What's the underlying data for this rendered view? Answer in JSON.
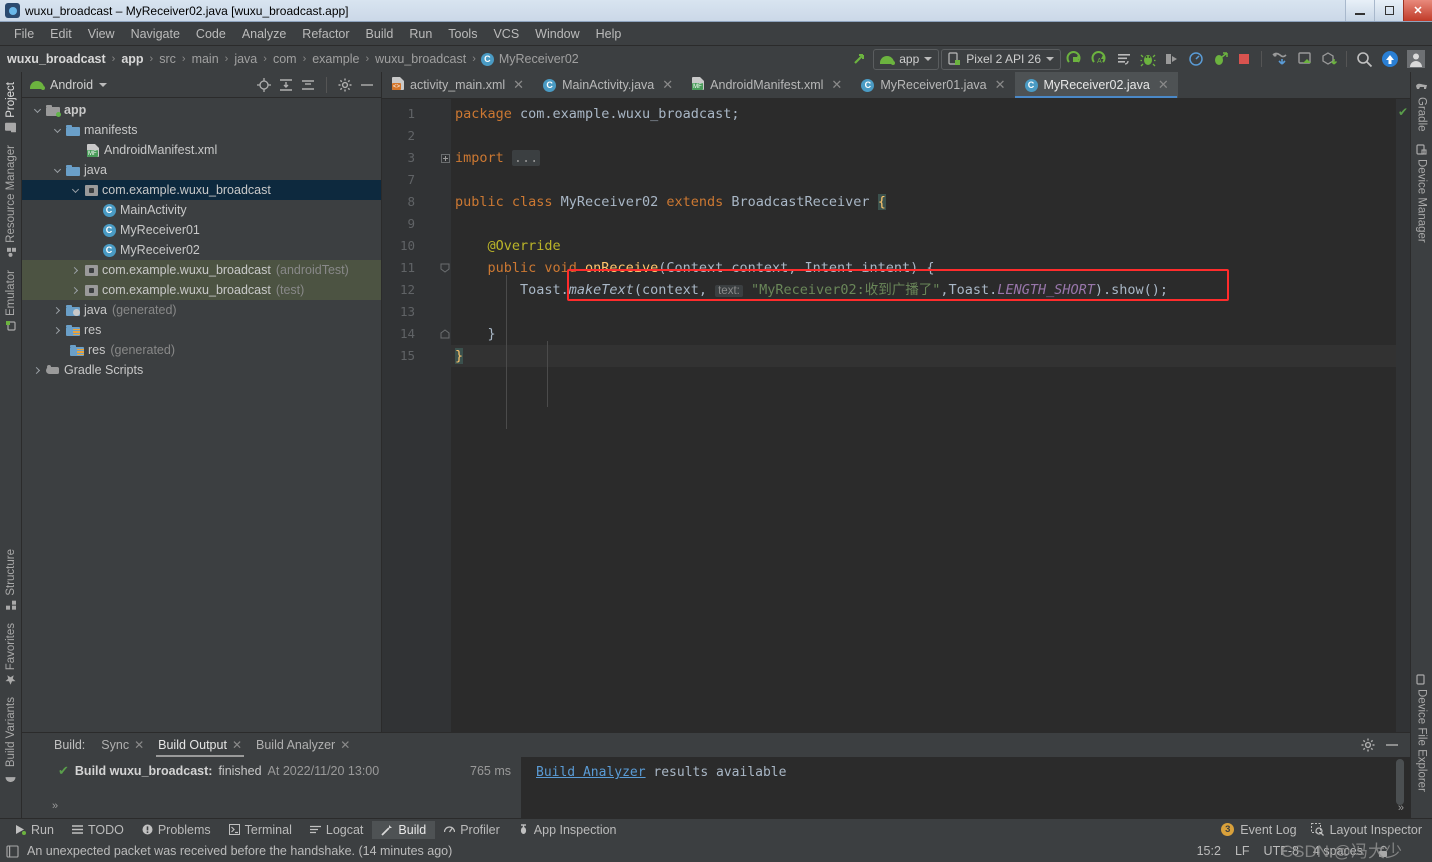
{
  "window": {
    "title": "wuxu_broadcast – MyReceiver02.java [wuxu_broadcast.app]",
    "minimize": "–",
    "maximize": "❐",
    "close": "✕"
  },
  "menubar": {
    "items": [
      "File",
      "Edit",
      "View",
      "Navigate",
      "Code",
      "Analyze",
      "Refactor",
      "Build",
      "Run",
      "Tools",
      "VCS",
      "Window",
      "Help"
    ]
  },
  "navbar": {
    "breadcrumbs": [
      {
        "label": "wuxu_broadcast",
        "bold": true
      },
      {
        "label": "app",
        "bold": true
      },
      {
        "label": "src",
        "bold": false
      },
      {
        "label": "main",
        "bold": false
      },
      {
        "label": "java",
        "bold": false
      },
      {
        "label": "com",
        "bold": false
      },
      {
        "label": "example",
        "bold": false
      },
      {
        "label": "wuxu_broadcast",
        "bold": false
      },
      {
        "label": "MyReceiver02",
        "bold": false,
        "icon": "class-icon",
        "badge": "C"
      }
    ],
    "separator": "›",
    "module_selector": "app",
    "device_selector": "Pixel 2 API 26",
    "icons": [
      "make-project-icon",
      "app-run-config-icon",
      "device-selector-icon",
      "run-icon",
      "debug-icon",
      "logcat-icon",
      "profiler-icon",
      "attach-debugger-icon",
      "avd-manager-icon",
      "sdk-manager-icon",
      "stop-icon",
      "layout-inspector-icon",
      "device-file-explorer-icon",
      "apk-analyzer-icon",
      "search-icon",
      "update-icon",
      "avatar-icon"
    ]
  },
  "left_strip": {
    "items": [
      {
        "label": "Project",
        "icon": "project-icon",
        "active": true
      },
      {
        "label": "Resource Manager",
        "icon": "resource-manager-icon",
        "active": false
      },
      {
        "label": "Emulator",
        "icon": "emulator-icon",
        "active": false
      },
      {
        "label": "Structure",
        "icon": "structure-icon",
        "active": false
      },
      {
        "label": "Favorites",
        "icon": "star-icon",
        "active": false
      },
      {
        "label": "Build Variants",
        "icon": "android-icon",
        "active": false
      }
    ]
  },
  "right_strip": {
    "items": [
      {
        "label": "Gradle",
        "icon": "gradle-elephant-icon"
      },
      {
        "label": "Device Manager",
        "icon": "device-manager-icon"
      },
      {
        "label": "Device File Explorer",
        "icon": "device-file-explorer-icon"
      }
    ]
  },
  "project_panel": {
    "title": "Android",
    "dropdown_icon": "chevron-down-icon",
    "toolbar_icons": [
      "locate-icon",
      "expand-all-icon",
      "collapse-all-icon",
      "settings-gear-icon",
      "hide-icon"
    ],
    "tree": [
      {
        "indent": 0,
        "arrow": "down",
        "icon": "module-folder-icon",
        "label": "app",
        "suffix": "",
        "bold": true,
        "state": "none"
      },
      {
        "indent": 1,
        "arrow": "down",
        "icon": "folder-icon",
        "label": "manifests",
        "suffix": "",
        "bold": false,
        "state": "none"
      },
      {
        "indent": 2,
        "arrow": "none",
        "icon": "manifest-xml-icon",
        "label": "AndroidManifest.xml",
        "suffix": "",
        "bold": false,
        "state": "none"
      },
      {
        "indent": 1,
        "arrow": "down",
        "icon": "folder-icon",
        "label": "java",
        "suffix": "",
        "bold": false,
        "state": "none"
      },
      {
        "indent": 2,
        "arrow": "down",
        "icon": "package-icon",
        "label": "com.example.wuxu_broadcast",
        "suffix": "",
        "bold": false,
        "state": "selected"
      },
      {
        "indent": 3,
        "arrow": "none",
        "icon": "class-icon",
        "label": "MainActivity",
        "suffix": "",
        "bold": false,
        "state": "none"
      },
      {
        "indent": 3,
        "arrow": "none",
        "icon": "class-icon",
        "label": "MyReceiver01",
        "suffix": "",
        "bold": false,
        "state": "none"
      },
      {
        "indent": 3,
        "arrow": "none",
        "icon": "class-icon",
        "label": "MyReceiver02",
        "suffix": "",
        "bold": false,
        "state": "none"
      },
      {
        "indent": 2,
        "arrow": "right",
        "icon": "package-icon",
        "label": "com.example.wuxu_broadcast",
        "suffix": "(androidTest)",
        "bold": false,
        "state": "green"
      },
      {
        "indent": 2,
        "arrow": "right",
        "icon": "package-icon",
        "label": "com.example.wuxu_broadcast",
        "suffix": "(test)",
        "bold": false,
        "state": "green"
      },
      {
        "indent": 1,
        "arrow": "right",
        "icon": "java-generated-icon",
        "label": "java",
        "suffix": "(generated)",
        "bold": false,
        "state": "none"
      },
      {
        "indent": 1,
        "arrow": "right",
        "icon": "res-folder-icon",
        "label": "res",
        "suffix": "",
        "bold": false,
        "state": "none"
      },
      {
        "indent": 1,
        "arrow": "none",
        "icon": "res-folder-icon",
        "label": "res",
        "suffix": "(generated)",
        "bold": false,
        "state": "none"
      },
      {
        "indent": 0,
        "arrow": "right",
        "icon": "gradle-elephant-icon",
        "label": "Gradle Scripts",
        "suffix": "",
        "bold": false,
        "state": "none"
      }
    ]
  },
  "editor": {
    "tabs": [
      {
        "label": "activity_main.xml",
        "icon": "layout-xml-icon",
        "active": false,
        "close": "✕"
      },
      {
        "label": "MainActivity.java",
        "icon": "class-icon",
        "active": false,
        "close": "✕"
      },
      {
        "label": "AndroidManifest.xml",
        "icon": "manifest-xml-icon",
        "active": false,
        "close": "✕"
      },
      {
        "label": "MyReceiver01.java",
        "icon": "class-icon",
        "active": false,
        "close": "✕"
      },
      {
        "label": "MyReceiver02.java",
        "icon": "class-icon",
        "active": true,
        "close": "✕"
      }
    ],
    "line_numbers": [
      "1",
      "2",
      "3",
      "7",
      "8",
      "9",
      "10",
      "11",
      "12",
      "13",
      "14",
      "15"
    ],
    "lines": [
      {
        "n": "1",
        "tokens": [
          {
            "t": "package ",
            "c": "kw"
          },
          {
            "t": "com.example.wuxu_broadcast;",
            "c": "ident"
          }
        ]
      },
      {
        "n": "2",
        "tokens": []
      },
      {
        "n": "3",
        "tokens": [
          {
            "t": "import ",
            "c": "kw"
          },
          {
            "t": "...",
            "c": "ellips"
          }
        ]
      },
      {
        "n": "7",
        "tokens": []
      },
      {
        "n": "8",
        "tokens": [
          {
            "t": "public class ",
            "c": "kw"
          },
          {
            "t": "MyReceiver02 ",
            "c": "ident"
          },
          {
            "t": "extends ",
            "c": "kw"
          },
          {
            "t": "BroadcastReceiver ",
            "c": "ident"
          },
          {
            "t": "{",
            "c": "brmatch"
          }
        ]
      },
      {
        "n": "9",
        "tokens": []
      },
      {
        "n": "10",
        "tokens": [
          {
            "t": "    @Override",
            "c": "ann"
          }
        ]
      },
      {
        "n": "11",
        "tokens": [
          {
            "t": "    public void ",
            "c": "kw"
          },
          {
            "t": "onReceive",
            "c": "mth"
          },
          {
            "t": "(Context context, Intent intent) {",
            "c": "ident"
          }
        ]
      },
      {
        "n": "12",
        "tokens": [
          {
            "t": "        Toast.",
            "c": "ident"
          },
          {
            "t": "makeText",
            "c": "ital"
          },
          {
            "t": "(context, ",
            "c": "ident"
          },
          {
            "t": "text:",
            "c": "hint"
          },
          {
            "t": " ",
            "c": "ident"
          },
          {
            "t": "\"MyReceiver02:收到广播了\"",
            "c": "str"
          },
          {
            "t": ",Toast.",
            "c": "ident"
          },
          {
            "t": "LENGTH_SHORT",
            "c": "fld"
          },
          {
            "t": ").show();",
            "c": "ident"
          }
        ]
      },
      {
        "n": "13",
        "tokens": []
      },
      {
        "n": "14",
        "tokens": [
          {
            "t": "    }",
            "c": "ident"
          }
        ]
      },
      {
        "n": "15",
        "tokens": [
          {
            "t": "}",
            "c": "brmatch"
          }
        ]
      }
    ],
    "gutter_marks": {
      "8": "layout-preview-icon",
      "11": "override-method-icon"
    },
    "highlight_box": {
      "line": "12",
      "note": "red annotation rectangle around Toast.makeText statement"
    },
    "inspection_ok_icon": "✔"
  },
  "build_panel": {
    "label": "Build:",
    "tabs": [
      {
        "label": "Sync",
        "active": false,
        "close": "✕"
      },
      {
        "label": "Build Output",
        "active": true,
        "close": "✕"
      },
      {
        "label": "Build Analyzer",
        "active": false,
        "close": "✕"
      }
    ],
    "tools": [
      "settings-gear-icon",
      "hide-icon"
    ],
    "result": {
      "status_icon": "✔",
      "title": "Build wuxu_broadcast:",
      "state": "finished",
      "timestamp": "At 2022/11/20 13:00",
      "duration": "765 ms"
    },
    "right_message": {
      "link": "Build Analyzer",
      "text": " results available"
    },
    "expand_icon": "»"
  },
  "bottom_bar": {
    "items": [
      {
        "label": "Run",
        "icon": "run-icon",
        "active": false
      },
      {
        "label": "TODO",
        "icon": "todo-icon",
        "active": false
      },
      {
        "label": "Problems",
        "icon": "problems-icon",
        "active": false
      },
      {
        "label": "Terminal",
        "icon": "terminal-icon",
        "active": false
      },
      {
        "label": "Logcat",
        "icon": "logcat-icon",
        "active": false
      },
      {
        "label": "Build",
        "icon": "build-hammer-icon",
        "active": true
      },
      {
        "label": "Profiler",
        "icon": "profiler-icon",
        "active": false
      },
      {
        "label": "App Inspection",
        "icon": "app-inspection-icon",
        "active": false
      }
    ],
    "right": [
      {
        "label": "Event Log",
        "badge": "3",
        "icon": "event-log-icon"
      },
      {
        "label": "Layout Inspector",
        "icon": "layout-inspector-icon"
      }
    ]
  },
  "status_bar": {
    "message_icon": "notification-icon",
    "message": "An unexpected packet was received before the handshake. (14 minutes ago)",
    "caret_position": "15:2",
    "line_separator": "LF",
    "encoding": "UTF-8",
    "indent": "4 spaces",
    "lock_icon": "unlocked-icon",
    "watermark": "CSDN @冯大少"
  },
  "colors": {
    "accent_blue": "#4a88c7",
    "editor_bg": "#2b2b2b",
    "panel_bg": "#3c3f41",
    "selection": "#0d293e",
    "green_row": "#4c5342",
    "annotation_red": "#ff2c2c",
    "string_green": "#6a8759",
    "keyword_orange": "#cc7832",
    "method_yellow": "#ffc66d",
    "field_purple": "#9876aa",
    "annotation_yellow": "#bbb529"
  }
}
